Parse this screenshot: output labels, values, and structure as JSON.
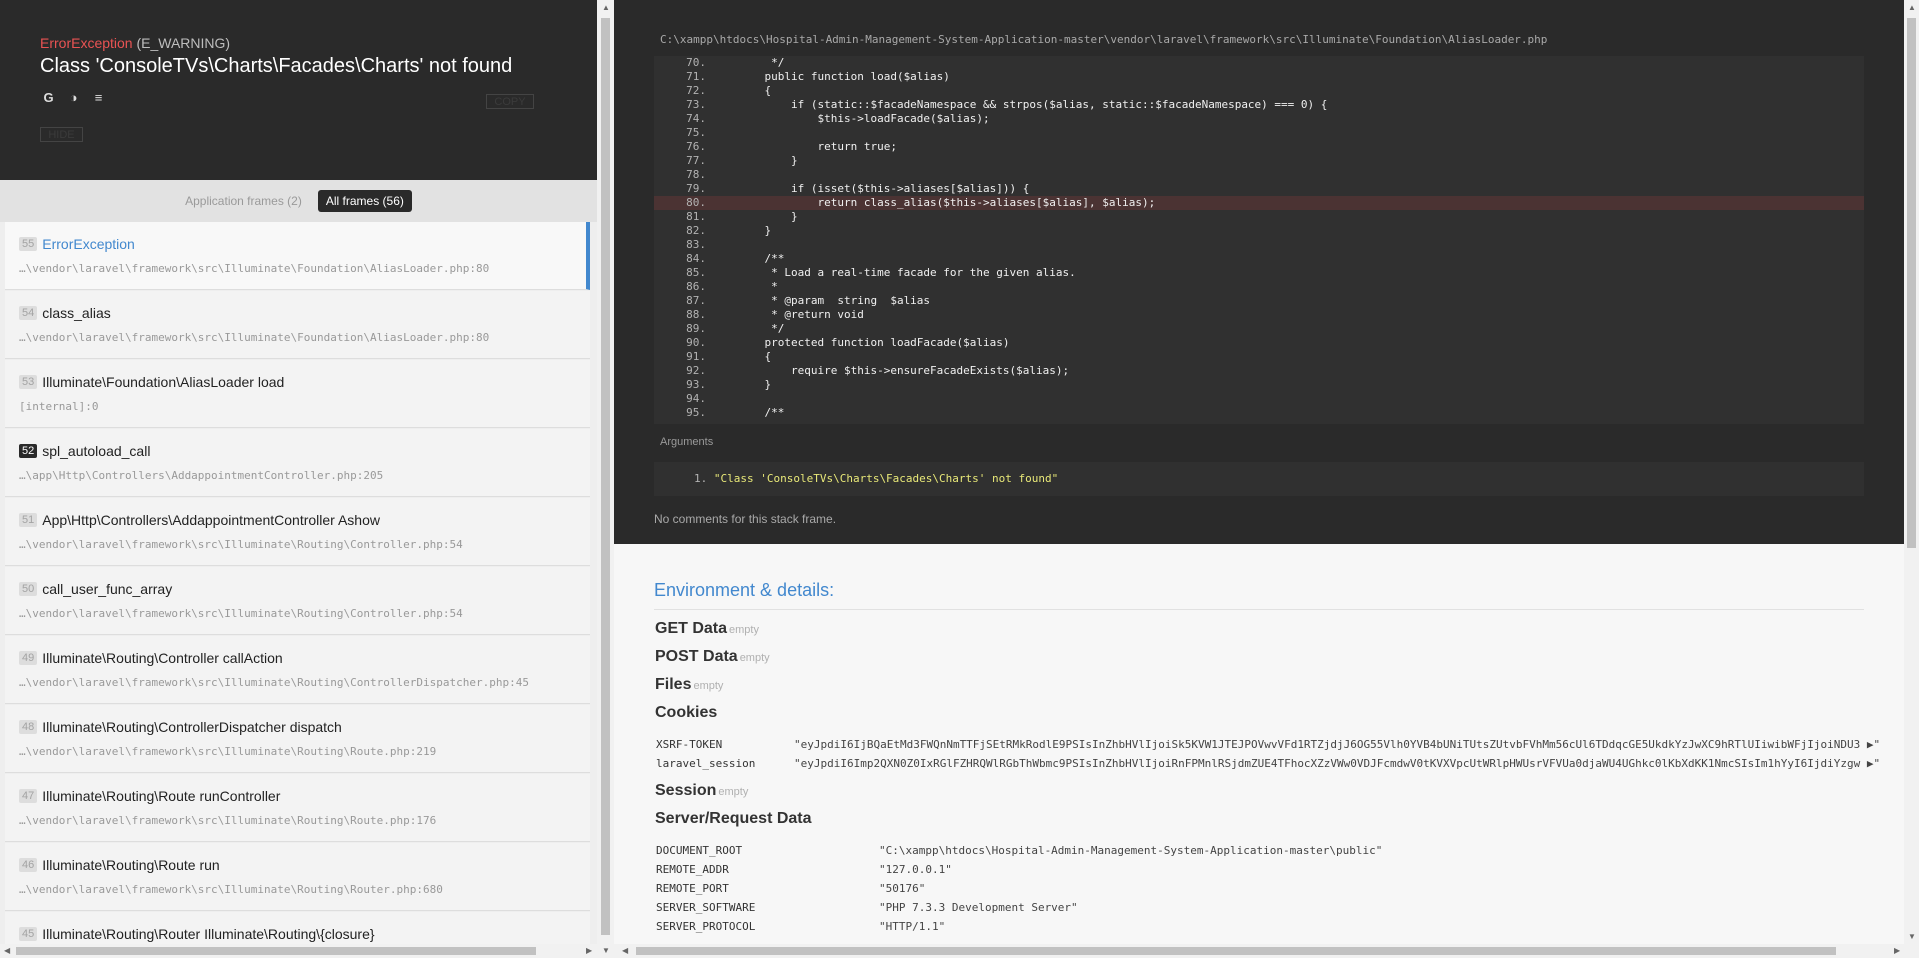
{
  "exception": {
    "type_name": "ErrorException",
    "type_suffix": "(E_WARNING)",
    "message": "Class 'ConsoleTVs\\Charts\\Facades\\Charts' not found",
    "copy_label": "COPY",
    "hide_label": "HIDE",
    "search_icons": [
      "google-icon",
      "duckduckgo-icon",
      "stackoverflow-icon"
    ]
  },
  "frame_filter": {
    "application": "Application frames (2)",
    "all": "All frames (56)"
  },
  "frames": [
    {
      "index": "55",
      "class": "ErrorException",
      "file": "…\\vendor\\laravel\\framework\\src\\Illuminate\\Foundation\\AliasLoader.php:80"
    },
    {
      "index": "54",
      "class": "class_alias",
      "file": "…\\vendor\\laravel\\framework\\src\\Illuminate\\Foundation\\AliasLoader.php:80"
    },
    {
      "index": "53",
      "class": "Illuminate\\Foundation\\AliasLoader load",
      "file": "[internal]:0"
    },
    {
      "index": "52",
      "class": "spl_autoload_call",
      "file": "…\\app\\Http\\Controllers\\AddappointmentController.php:205"
    },
    {
      "index": "51",
      "class": "App\\Http\\Controllers\\AddappointmentController Ashow",
      "file": "…\\vendor\\laravel\\framework\\src\\Illuminate\\Routing\\Controller.php:54"
    },
    {
      "index": "50",
      "class": "call_user_func_array",
      "file": "…\\vendor\\laravel\\framework\\src\\Illuminate\\Routing\\Controller.php:54"
    },
    {
      "index": "49",
      "class": "Illuminate\\Routing\\Controller callAction",
      "file": "…\\vendor\\laravel\\framework\\src\\Illuminate\\Routing\\ControllerDispatcher.php:45"
    },
    {
      "index": "48",
      "class": "Illuminate\\Routing\\ControllerDispatcher dispatch",
      "file": "…\\vendor\\laravel\\framework\\src\\Illuminate\\Routing\\Route.php:219"
    },
    {
      "index": "47",
      "class": "Illuminate\\Routing\\Route runController",
      "file": "…\\vendor\\laravel\\framework\\src\\Illuminate\\Routing\\Route.php:176"
    },
    {
      "index": "46",
      "class": "Illuminate\\Routing\\Route run",
      "file": "…\\vendor\\laravel\\framework\\src\\Illuminate\\Routing\\Router.php:680"
    },
    {
      "index": "45",
      "class": "Illuminate\\Routing\\Router Illuminate\\Routing\\{closure}",
      "file": ""
    }
  ],
  "code": {
    "file_path": "C:\\xampp\\htdocs\\Hospital-Admin-Management-System-Application-master\\vendor\\laravel\\framework\\src\\Illuminate\\Foundation\\AliasLoader.php",
    "lines": [
      {
        "n": "70.",
        "t": "     */"
      },
      {
        "n": "71.",
        "t": "    public function load($alias)"
      },
      {
        "n": "72.",
        "t": "    {"
      },
      {
        "n": "73.",
        "t": "        if (static::$facadeNamespace && strpos($alias, static::$facadeNamespace) === 0) {"
      },
      {
        "n": "74.",
        "t": "            $this->loadFacade($alias);"
      },
      {
        "n": "75.",
        "t": ""
      },
      {
        "n": "76.",
        "t": "            return true;"
      },
      {
        "n": "77.",
        "t": "        }"
      },
      {
        "n": "78.",
        "t": ""
      },
      {
        "n": "79.",
        "t": "        if (isset($this->aliases[$alias])) {"
      },
      {
        "n": "80.",
        "t": "            return class_alias($this->aliases[$alias], $alias);"
      },
      {
        "n": "81.",
        "t": "        }"
      },
      {
        "n": "82.",
        "t": "    }"
      },
      {
        "n": "83.",
        "t": ""
      },
      {
        "n": "84.",
        "t": "    /**"
      },
      {
        "n": "85.",
        "t": "     * Load a real-time facade for the given alias."
      },
      {
        "n": "86.",
        "t": "     *"
      },
      {
        "n": "87.",
        "t": "     * @param  string  $alias"
      },
      {
        "n": "88.",
        "t": "     * @return void"
      },
      {
        "n": "89.",
        "t": "     */"
      },
      {
        "n": "90.",
        "t": "    protected function loadFacade($alias)"
      },
      {
        "n": "91.",
        "t": "    {"
      },
      {
        "n": "92.",
        "t": "        require $this->ensureFacadeExists($alias);"
      },
      {
        "n": "93.",
        "t": "    }"
      },
      {
        "n": "94.",
        "t": ""
      },
      {
        "n": "95.",
        "t": "    /**"
      }
    ],
    "arguments_title": "Arguments",
    "argument_number": "1.",
    "argument_value": "\"Class 'ConsoleTVs\\Charts\\Facades\\Charts' not found\"",
    "no_comments": "No comments for this stack frame."
  },
  "environment": {
    "title": "Environment & details:",
    "empty_label": "empty",
    "get_data": "GET Data",
    "post_data": "POST Data",
    "files": "Files",
    "cookies": "Cookies",
    "cookie_rows": [
      {
        "key": "XSRF-TOKEN",
        "value": "\"eyJpdiI6IjBQaEtMd3FWQnNmTTFjSEtRMkRodlE9PSIsInZhbHVlIjoiSk5KVW1JTEJPOVwvVFd1RTZjdjJ6OG55Vlh0YVB4bUNiTUtsZUtvbFVhMm56cUl6TDdqcGE5UkdkYzJwXC9hRTlUIiwibWFjIjoiNDU3 ▶\""
      },
      {
        "key": "laravel_session",
        "value": "\"eyJpdiI6Imp2QXN0Z0IxRGlFZHRQWlRGbThWbmc9PSIsInZhbHVlIjoiRnFPMnlRSjdmZUE4TFhocXZzVWw0VDJFcmdwV0tKVXVpcUtWRlpHWUsrVFVUa0djaWU4UGhkc0lKbXdKK1NmcSIsIm1hYyI6IjdiYzgw ▶\""
      }
    ],
    "session": "Session",
    "server_request": "Server/Request Data",
    "server_rows": [
      {
        "key": "DOCUMENT_ROOT",
        "value": "\"C:\\xampp\\htdocs\\Hospital-Admin-Management-System-Application-master\\public\""
      },
      {
        "key": "REMOTE_ADDR",
        "value": "\"127.0.0.1\""
      },
      {
        "key": "REMOTE_PORT",
        "value": "\"50176\""
      },
      {
        "key": "SERVER_SOFTWARE",
        "value": "\"PHP 7.3.3 Development Server\""
      },
      {
        "key": "SERVER_PROTOCOL",
        "value": "\"HTTP/1.1\""
      }
    ]
  }
}
